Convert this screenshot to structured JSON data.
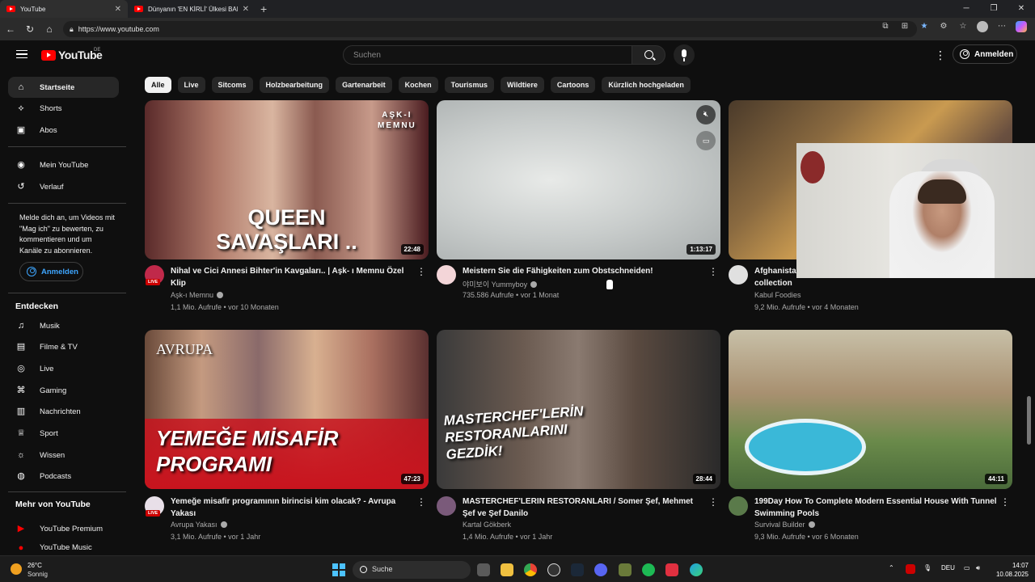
{
  "browser": {
    "tabs": [
      {
        "title": "YouTube",
        "active": true
      },
      {
        "title": "Dünyanın 'EN KİRLİ' Ülkesi BANG...",
        "active": false
      }
    ],
    "url": "https://www.youtube.com"
  },
  "youtube": {
    "logo_text": "YouTube",
    "logo_region": "DE",
    "search_placeholder": "Suchen",
    "signin_label": "Anmelden",
    "sidebar": {
      "main": [
        {
          "label": "Startseite",
          "icon": "home-icon",
          "active": true
        },
        {
          "label": "Shorts",
          "icon": "shorts-icon"
        },
        {
          "label": "Abos",
          "icon": "subscriptions-icon"
        }
      ],
      "you": [
        {
          "label": "Mein YouTube",
          "icon": "user-circle-icon"
        },
        {
          "label": "Verlauf",
          "icon": "history-icon"
        }
      ],
      "signin_message": "Melde dich an, um Videos mit \"Mag ich\" zu bewerten, zu kommentieren und um Kanäle zu abonnieren.",
      "signin_label": "Anmelden",
      "explore_title": "Entdecken",
      "explore": [
        {
          "label": "Musik",
          "icon": "music-icon"
        },
        {
          "label": "Filme & TV",
          "icon": "film-icon"
        },
        {
          "label": "Live",
          "icon": "live-icon"
        },
        {
          "label": "Gaming",
          "icon": "gaming-icon"
        },
        {
          "label": "Nachrichten",
          "icon": "news-icon"
        },
        {
          "label": "Sport",
          "icon": "trophy-icon"
        },
        {
          "label": "Wissen",
          "icon": "bulb-icon"
        },
        {
          "label": "Podcasts",
          "icon": "podcast-icon"
        }
      ],
      "more_title": "Mehr von YouTube",
      "more": [
        {
          "label": "YouTube Premium",
          "icon": "youtube-premium-icon"
        },
        {
          "label": "YouTube Music",
          "icon": "youtube-music-icon"
        }
      ]
    },
    "chips": [
      "Alle",
      "Live",
      "Sitcoms",
      "Holzbearbeitung",
      "Gartenarbeit",
      "Kochen",
      "Tourismus",
      "Wildtiere",
      "Cartoons",
      "Kürzlich hochgeladen"
    ],
    "videos": [
      {
        "title": "Nihal ve Cici Annesi Bihter'in Kavgaları.. | Aşk- ı Memnu Özel Klip",
        "channel": "Aşk-ı Memnu",
        "verified": true,
        "meta": "1,1 Mio. Aufrufe • vor 10 Monaten",
        "duration": "22:48",
        "thumb_text": "QUEEN\nSAVAŞLARI ..",
        "thumb_brand": "AŞK-I\nMEMNU",
        "live": true
      },
      {
        "title": "Meistern Sie die Fähigkeiten zum Obstschneiden!",
        "channel": "야미보이 Yummyboy",
        "verified": true,
        "meta": "735.586 Aufrufe • vor 1 Monat",
        "duration": "1:13:17"
      },
      {
        "title": "Afghanista... collection",
        "title_line1": "Afghanista",
        "title_line2": "collection",
        "channel": "Kabul Foodies",
        "meta": "9,2 Mio. Aufrufe • vor 4 Monaten"
      },
      {
        "title": "Yemeğe misafir programının birincisi kim olacak? - Avrupa Yakası",
        "channel": "Avrupa Yakası",
        "verified": true,
        "meta": "3,1 Mio. Aufrufe • vor 1 Jahr",
        "duration": "47:23",
        "thumb_text": "YEMEĞE MİSAFİR\nPROGRAMI",
        "thumb_brand": "AVRUPA",
        "live": true
      },
      {
        "title": "MASTERCHEF'LERIN RESTORANLARI / Somer Şef, Mehmet Şef ve Şef Danilo",
        "channel": "Kartal Gökberk",
        "meta": "1,4 Mio. Aufrufe • vor 1 Jahr",
        "duration": "28:44",
        "thumb_text": "MASTERCHEF'LERİN\nRESTORANLARINI\nGEZDİK!"
      },
      {
        "title": "199Day How To Complete Modern Essential House With Tunnel Swimming Pools",
        "channel": "Survival Builder",
        "verified": true,
        "meta": "9,3 Mio. Aufrufe • vor 6 Monaten",
        "duration": "44:11"
      }
    ]
  },
  "taskbar": {
    "weather_temp": "26°C",
    "weather_desc": "Sonnig",
    "search_label": "Suche",
    "lang": "DEU",
    "time": "14:07",
    "date": "10.08.2025"
  },
  "colors": {
    "accent_red": "#ff0000",
    "link_blue": "#3ea6ff",
    "bg": "#0f0f0f"
  }
}
